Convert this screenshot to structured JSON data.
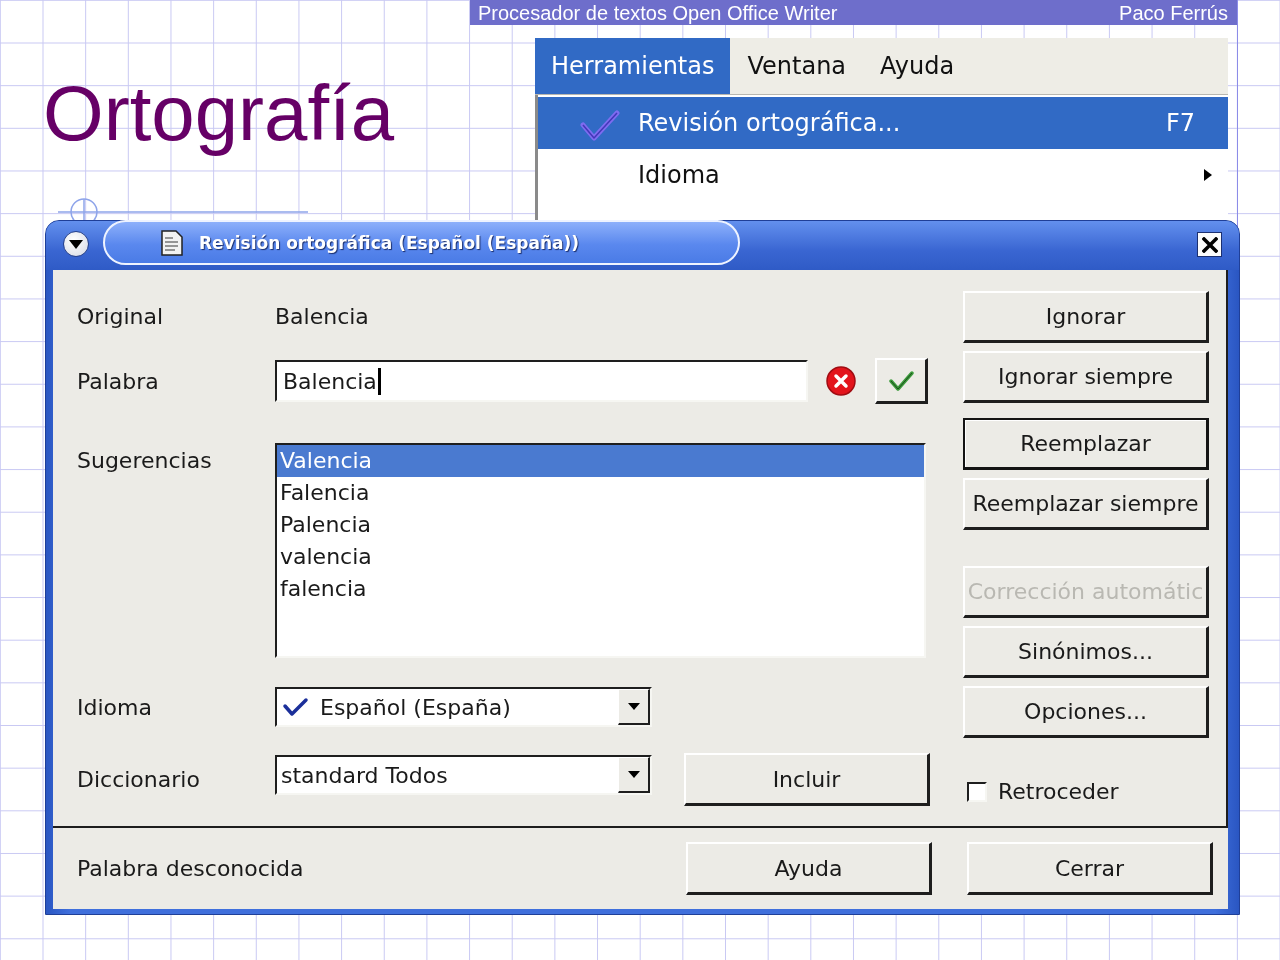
{
  "slide": {
    "header_left": "Procesador de textos Open Office Writer",
    "header_right": "Paco Ferrús",
    "title": "Ortografía"
  },
  "menu": {
    "bar": [
      {
        "label": "Herramientas",
        "selected": true
      },
      {
        "label": "Ventana",
        "selected": false
      },
      {
        "label": "Ayuda",
        "selected": false
      }
    ],
    "items": [
      {
        "label": "Revisión ortográfica...",
        "shortcut": "F7",
        "has_icon": true,
        "has_submenu": false,
        "selected": true
      },
      {
        "label": "Idioma",
        "has_icon": false,
        "has_submenu": true,
        "selected": false
      }
    ]
  },
  "dialog": {
    "title": "Revisión ortográfica (Español (España))",
    "original": {
      "label": "Original",
      "value": "Balencia"
    },
    "word": {
      "label": "Palabra",
      "value": "Balencia",
      "focused": true,
      "unknown": true
    },
    "suggestions": {
      "label": "Sugerencias",
      "items": [
        {
          "text": "Valencia",
          "selected": true
        },
        {
          "text": "Falencia",
          "selected": false
        },
        {
          "text": "Palencia",
          "selected": false
        },
        {
          "text": "valencia",
          "selected": false
        },
        {
          "text": "falencia",
          "selected": false
        }
      ]
    },
    "language": {
      "label": "Idioma",
      "value": "Español (España)"
    },
    "dictionary": {
      "label": "Diccionario",
      "value": "standard Todos"
    },
    "include_button": "Incluir",
    "side_buttons": [
      [
        {
          "label": "Ignorar",
          "default": false,
          "disabled": false
        },
        {
          "label": "Ignorar siempre",
          "default": false,
          "disabled": false
        }
      ],
      [
        {
          "label": "Reemplazar",
          "default": true,
          "disabled": false
        },
        {
          "label": "Reemplazar siempre",
          "default": false,
          "disabled": false
        }
      ],
      [
        {
          "label": "Corrección automátic",
          "default": false,
          "disabled": true
        },
        {
          "label": "Sinónimos...",
          "default": false,
          "disabled": false
        },
        {
          "label": "Opciones...",
          "default": false,
          "disabled": false
        }
      ]
    ],
    "backwards": {
      "label": "Retroceder",
      "checked": false
    },
    "status": "Palabra desconocida",
    "help_button": "Ayuda",
    "close_button": "Cerrar"
  }
}
